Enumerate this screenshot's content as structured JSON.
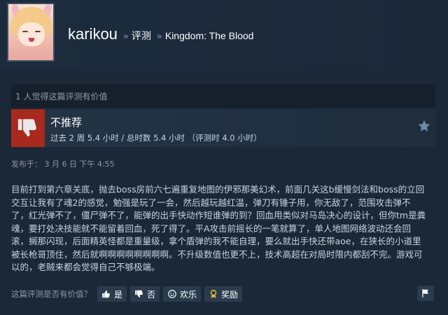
{
  "header": {
    "username": "karikou",
    "crumb_sep_1": "»",
    "crumb_review": "评测",
    "crumb_sep_2": "»",
    "game_title": "Kingdom: The Blood"
  },
  "review": {
    "helpful_count_text": "1 人觉得这篇评测有价值",
    "recommendation": "不推荐",
    "hours_text": "过去 2 周 5.4 小时 / 总时数 5.4 小时 （评测时 4.0 小时）",
    "posted_text": "发布于： 3 月 6 日 下午 4:55",
    "body": "目前打到第六章关底，抛去boss房前六七遍重复地图的伊邪那美幻术，前面几关这b缓慢剑法和boss的立回交互让我有了魂2的感觉，勉强是玩了一会，然后越玩越红温，弹刀有锤子用，你无敌了，范围攻击弹不了，红光弹不了，僵尸弹不了，能弹的出手快动作短谁弹的到？回血用类似对马岛决心的设计，但你tm是粪魂，要打处决技能就不能留着回血，死了得了。平A攻击前摇长的一笔就算了，单人地图网络波动还会回滚，搁那闪现，后面精英怪都是重量级，拿个盾弹的我不能自理，要么就出手快还带aoe，在狭长的小道里被长枪哥顶住，然后就啊啊啊啊啊啊啊啊。不升级数值也更不上，技术高超在对局时限内都刮不完。游戏可以的，老贼来都会觉得自己不够极端。"
  },
  "footer": {
    "question": "这篇评测是否有价值？",
    "yes_label": "是",
    "no_label": "否",
    "funny_label": "欢乐",
    "award_label": "奖励"
  },
  "icons": {
    "recommendation": "thumbs-down-icon",
    "favorite": "star-icon",
    "report": "flag-icon"
  },
  "colors": {
    "background": "#1b2838",
    "not_recommended": "#a82a1c",
    "text": "#c6d4df",
    "muted": "#8f98a0"
  }
}
